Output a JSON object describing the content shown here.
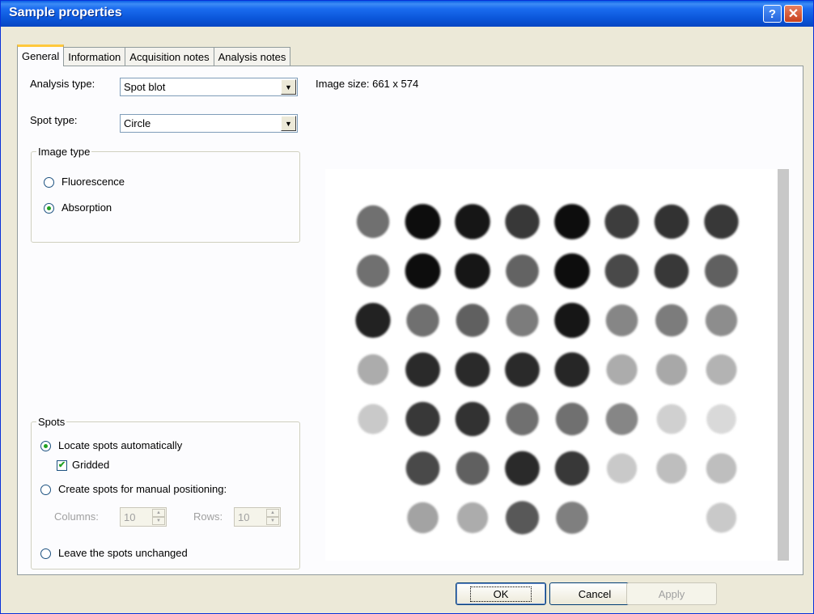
{
  "window": {
    "title": "Sample properties",
    "help": "?",
    "close": "✕"
  },
  "tabs": [
    "General",
    "Information",
    "Acquisition notes",
    "Analysis notes"
  ],
  "general": {
    "analysis_type_label": "Analysis type:",
    "analysis_type_value": "Spot blot",
    "spot_type_label": "Spot type:",
    "spot_type_value": "Circle",
    "image_size": "Image size: 661 x 574",
    "image_type": {
      "legend": "Image type",
      "options": [
        "Fluorescence",
        "Absorption"
      ],
      "selected": "Absorption"
    },
    "spots": {
      "legend": "Spots",
      "locate_auto": "Locate spots automatically",
      "gridded": "Gridded",
      "gridded_checked": true,
      "manual": "Create spots for manual positioning:",
      "columns_label": "Columns:",
      "columns_value": "10",
      "rows_label": "Rows:",
      "rows_value": "10",
      "leave": "Leave the spots unchanged",
      "selected": "Locate spots automatically"
    }
  },
  "buttons": {
    "ok": "OK",
    "cancel": "Cancel",
    "apply": "Apply"
  },
  "blot": {
    "rows": [
      [
        0.55,
        0.98,
        0.95,
        0.8,
        0.97,
        0.78,
        0.82,
        0.8
      ],
      [
        0.55,
        0.97,
        0.94,
        0.6,
        0.97,
        0.72,
        0.8,
        0.62
      ],
      [
        0.9,
        0.55,
        0.62,
        0.5,
        0.95,
        0.45,
        0.5,
        0.42
      ],
      [
        0.28,
        0.85,
        0.85,
        0.85,
        0.88,
        0.28,
        0.3,
        0.25
      ],
      [
        0.15,
        0.8,
        0.82,
        0.55,
        0.55,
        0.45,
        0.12,
        0.08
      ],
      [
        0.0,
        0.72,
        0.62,
        0.85,
        0.8,
        0.15,
        0.2,
        0.2
      ],
      [
        0.0,
        0.32,
        0.28,
        0.65,
        0.48,
        0.0,
        0.0,
        0.15
      ]
    ]
  }
}
